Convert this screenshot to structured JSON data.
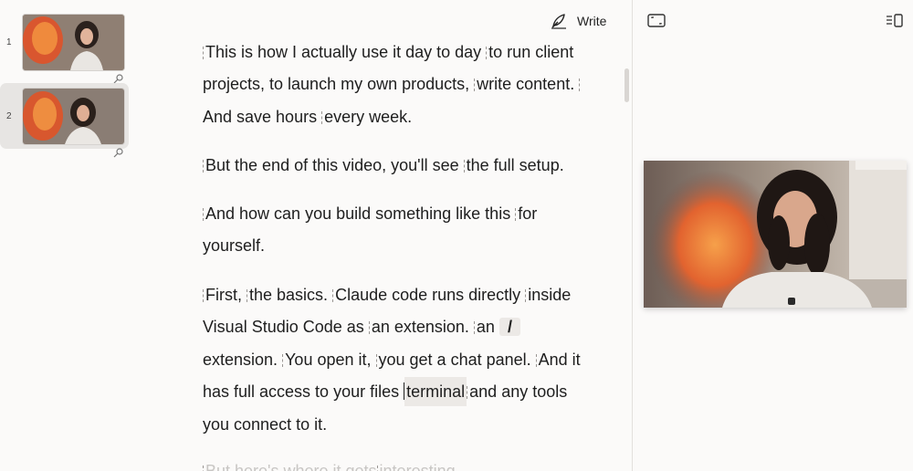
{
  "scenes": [
    {
      "number": "1",
      "selected": false
    },
    {
      "number": "2",
      "selected": true
    }
  ],
  "toolbar": {
    "write_label": "Write",
    "write_icon": "pen-nib-icon",
    "expand_icon": "fullscreen-icon",
    "layout_icon": "panel-layout-icon"
  },
  "script": {
    "p1": {
      "s1": "This is how I actually use it day to day",
      "s2": "to run client projects, to launch my own products,",
      "s3": "write content.",
      "s4": "And save hours",
      "s5": "every week."
    },
    "p2": {
      "s1": "But the end of this video, you'll see",
      "s2": "the full setup."
    },
    "p3": {
      "s1": "And how can you build something like this",
      "s2": "for yourself."
    },
    "p4": {
      "s1": "First,",
      "s2": "the basics.",
      "s3": "Claude code runs directly",
      "s4": "inside Visual Studio Code as",
      "s5": "an extension.",
      "s6": "an",
      "chip": "/",
      "s7": "extension.",
      "s8": "You open it,",
      "s9": "you get a chat panel.",
      "s10": "And it has full access to your files",
      "highlight": "terminal",
      "s11": "and any tools you connect to it."
    },
    "p5": {
      "s1": "But here's where it gets",
      "s2": "interesting."
    }
  },
  "colors": {
    "background": "#fbfaf9",
    "selected_scene": "#e7e5e3",
    "text": "#1e1e1e",
    "faded_text": "#c8c6c4"
  }
}
